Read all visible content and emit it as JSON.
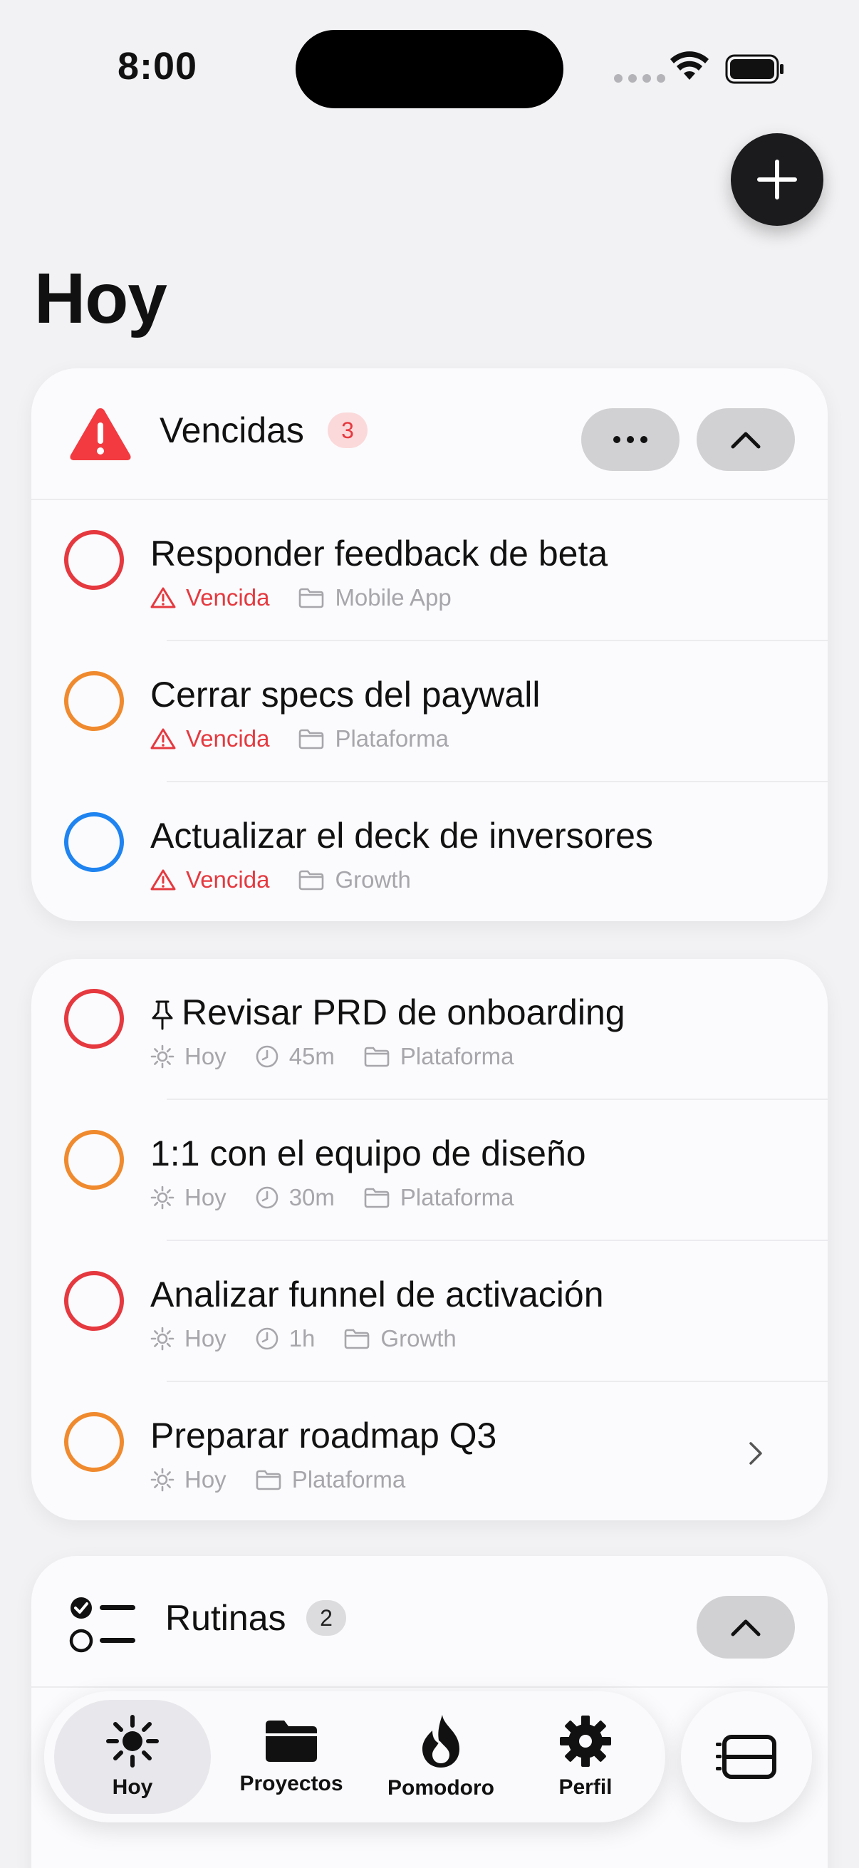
{
  "status_bar": {
    "time": "8:00"
  },
  "page_title": "Hoy",
  "overdue_section": {
    "title": "Vencidas",
    "count": "3",
    "tasks": [
      {
        "title": "Responder feedback de beta",
        "status": "Vencida",
        "project": "Mobile App",
        "color": "#e5393f"
      },
      {
        "title": "Cerrar specs del paywall",
        "status": "Vencida",
        "project": "Plataforma",
        "color": "#f08a2e"
      },
      {
        "title": "Actualizar el deck de inversores",
        "status": "Vencida",
        "project": "Growth",
        "color": "#1f84f0"
      }
    ]
  },
  "today_section": {
    "tasks": [
      {
        "title": "Revisar PRD de onboarding",
        "day": "Hoy",
        "duration": "45m",
        "project": "Plataforma",
        "color": "#e5393f",
        "pinned": true
      },
      {
        "title": "1:1 con el equipo de diseño",
        "day": "Hoy",
        "duration": "30m",
        "project": "Plataforma",
        "color": "#f08a2e"
      },
      {
        "title": "Analizar funnel de activación",
        "day": "Hoy",
        "duration": "1h",
        "project": "Growth",
        "color": "#e5393f"
      },
      {
        "title": "Preparar roadmap Q3",
        "day": "Hoy",
        "project": "Plataforma",
        "color": "#f08a2e"
      }
    ]
  },
  "routines_section": {
    "title": "Rutinas",
    "count": "2"
  },
  "tab_bar": {
    "tabs": [
      {
        "label": "Hoy",
        "icon": "sun-icon",
        "active": true
      },
      {
        "label": "Proyectos",
        "icon": "folder-icon"
      },
      {
        "label": "Pomodoro",
        "icon": "flame-icon"
      },
      {
        "label": "Perfil",
        "icon": "gear-icon"
      }
    ]
  },
  "colors": {
    "danger": "#e5393f",
    "warning": "#f08a2e",
    "info": "#1f84f0",
    "muted": "#a6a6ab"
  }
}
